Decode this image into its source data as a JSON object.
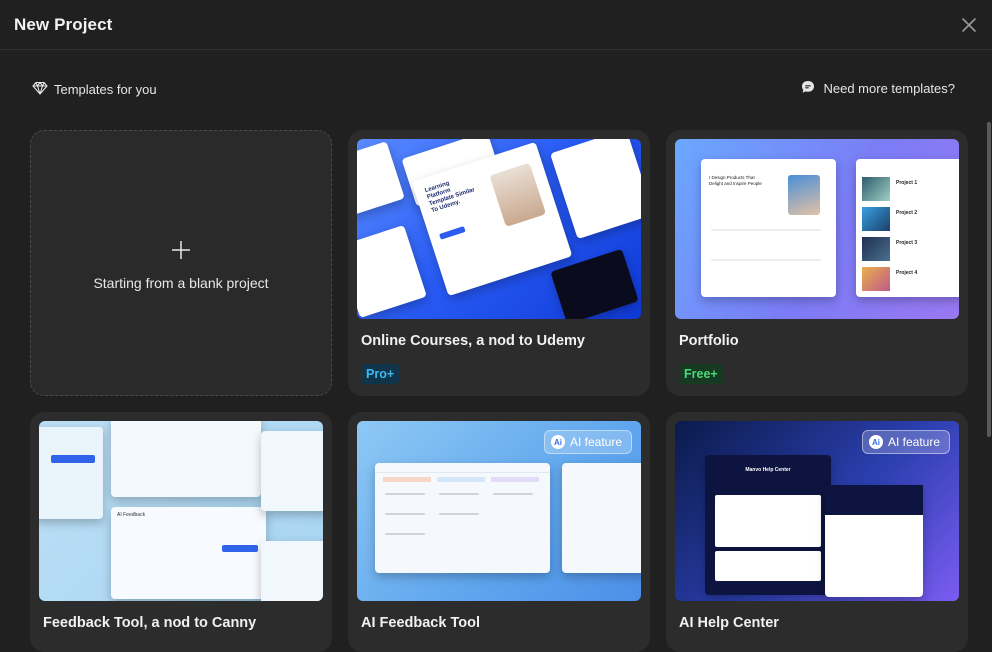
{
  "header": {
    "title": "New Project",
    "close_icon": "close-icon"
  },
  "subbar": {
    "templates_label": "Templates for you",
    "templates_icon": "diamond-icon",
    "need_more_label": "Need more templates?",
    "need_more_icon": "chat-bubble-icon"
  },
  "blank": {
    "label": "Starting from a blank project",
    "icon": "plus-icon"
  },
  "cards": [
    {
      "title": "Online Courses, a nod to Udemy",
      "badge": "Pro+",
      "badge_color": "#43b7f0"
    },
    {
      "title": "Portfolio",
      "badge": "Free+",
      "badge_color": "#4fd87a"
    },
    {
      "title": "Feedback Tool, a nod to Canny"
    },
    {
      "title": "AI Feedback Tool",
      "ai_badge": "AI feature"
    },
    {
      "title": "AI Help Center",
      "ai_badge": "AI feature"
    }
  ],
  "previews": {
    "udemy_heading": "Learning Platform Template Similar To Udemy.",
    "portfolio_heading": "I Design Products That Delight and Inspire People",
    "portfolio_projects": [
      "Project 1",
      "Project 2",
      "Project 3",
      "Project 4"
    ],
    "help_heading": "Manvo Help Center",
    "feedback_tab": "AI Feedback"
  },
  "colors": {
    "background": "#202020",
    "card": "#2c2c2c",
    "pro": "#43b7f0",
    "free": "#4fd87a"
  }
}
